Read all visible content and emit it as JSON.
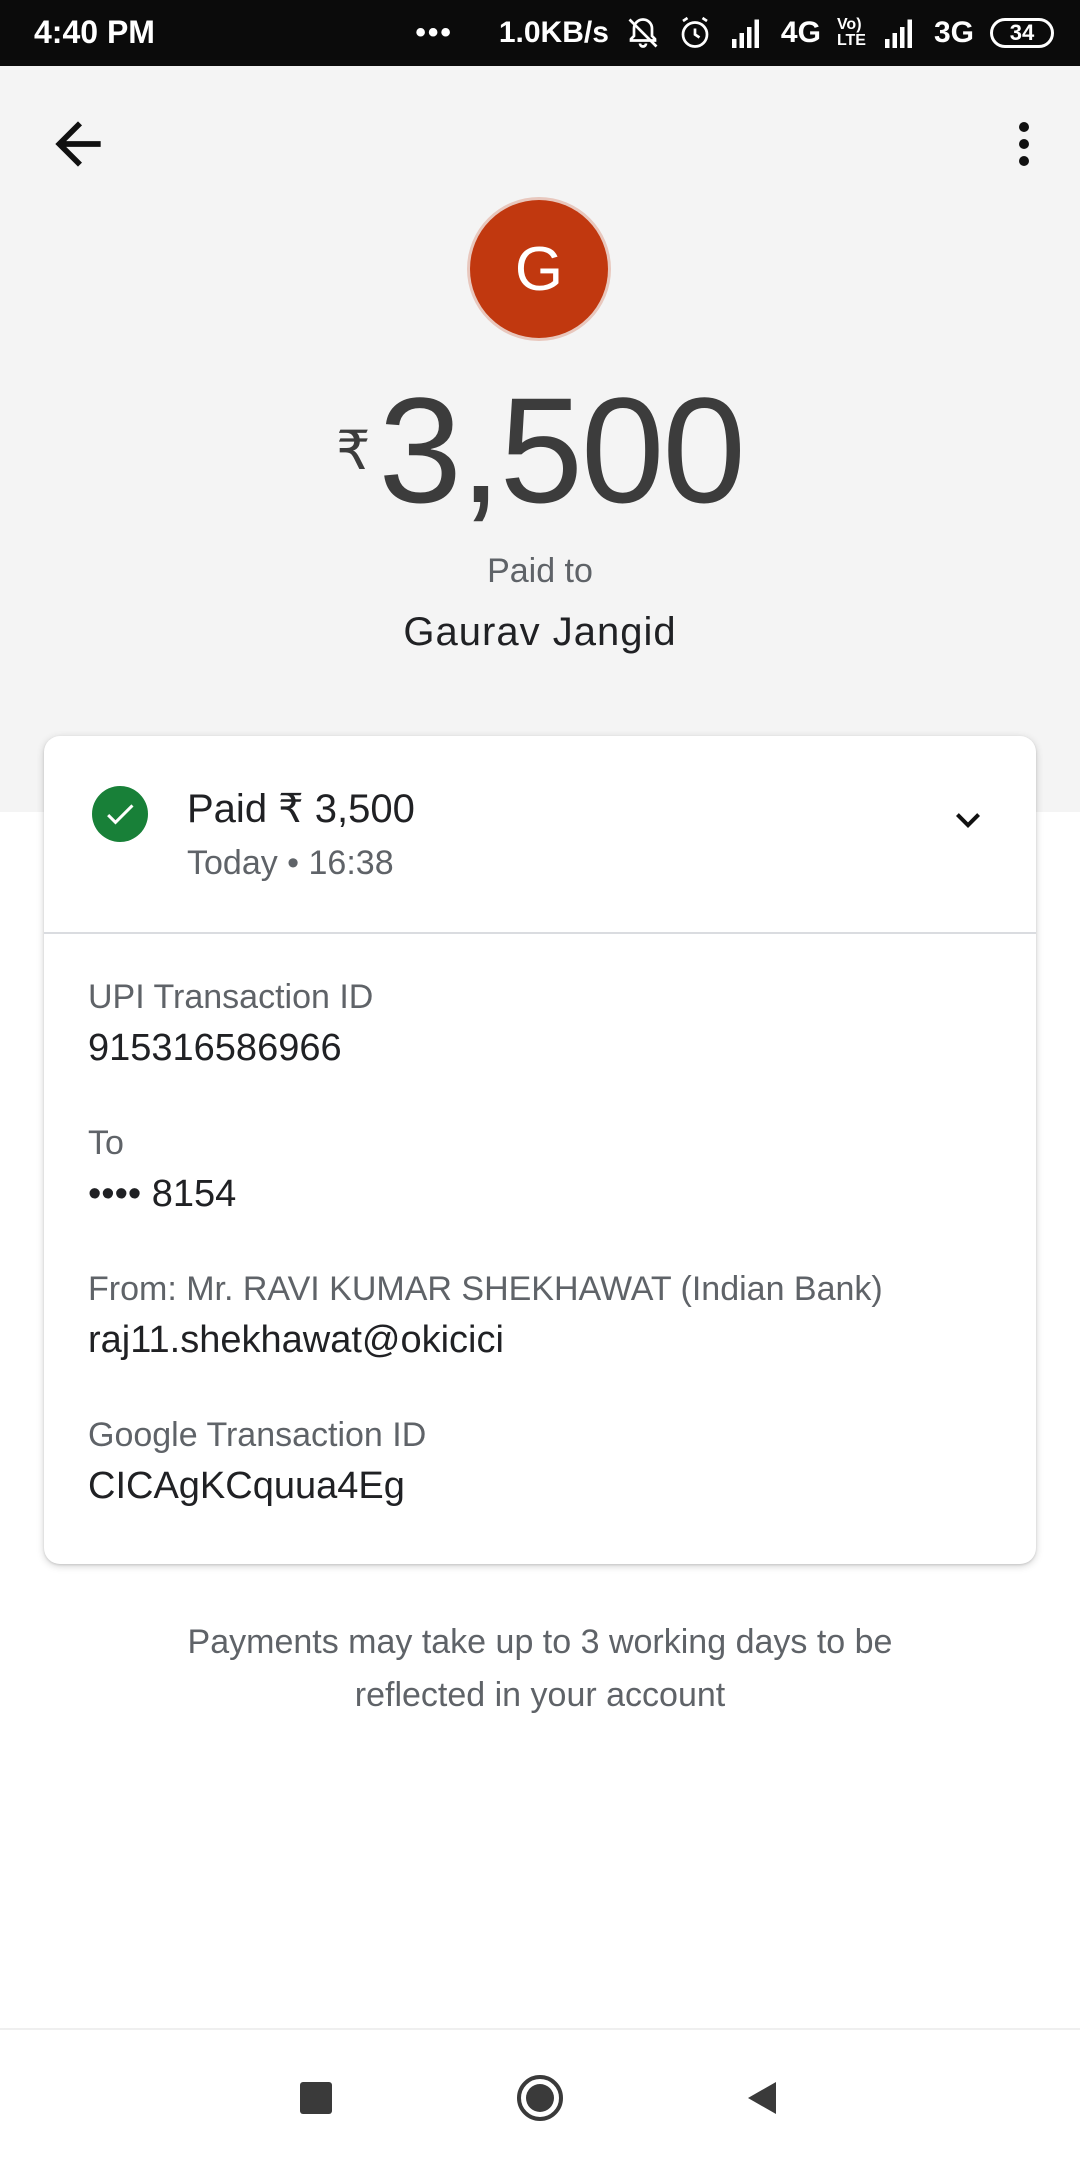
{
  "status_bar": {
    "time": "4:40 PM",
    "dots": "•••",
    "speed": "1.0KB/s",
    "network1": "4G",
    "volte_top": "Vo)",
    "volte_bottom": "LTE",
    "network2": "3G",
    "battery": "34"
  },
  "header": {
    "avatar_letter": "G",
    "avatar_color": "#c1380f",
    "currency_symbol": "₹",
    "amount": "3,500",
    "paid_to_label": "Paid to",
    "payee_name": "Gaurav Jangid"
  },
  "card": {
    "status_title": "Paid ₹ 3,500",
    "status_time": "Today • 16:38",
    "status_color": "#188038",
    "details": [
      {
        "label": "UPI Transaction ID",
        "value": "915316586966"
      },
      {
        "label": "To",
        "value": "•••• 8154"
      },
      {
        "label": "From: Mr. RAVI KUMAR SHEKHAWAT (Indian Bank)",
        "value": "raj11.shekhawat@okicici"
      },
      {
        "label": "Google Transaction ID",
        "value": "CICAgKCquua4Eg"
      }
    ]
  },
  "note": {
    "line1": "Payments may take up to 3 working days to be",
    "line2": "reflected in your account"
  },
  "icons": {
    "back": "arrow-left-icon",
    "more": "more-vert-icon",
    "check": "check-circle-icon",
    "expand": "chevron-down-icon"
  }
}
